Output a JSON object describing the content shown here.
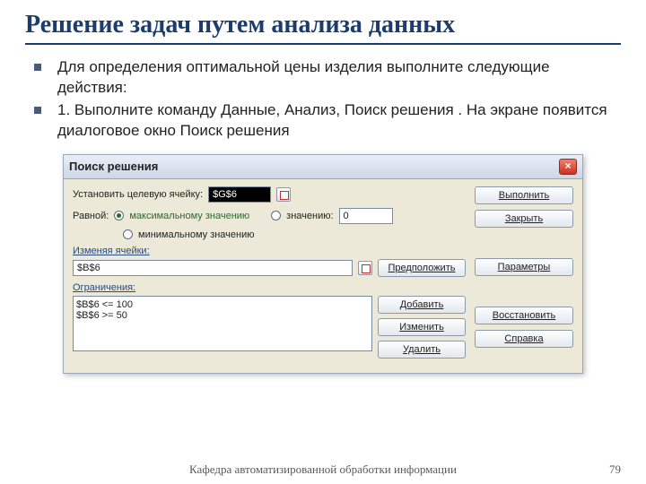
{
  "slide": {
    "title": "Решение задач путем анализа данных",
    "bullets": [
      "Для определения оптимальной цены изделия выполните следующие действия:",
      "1. Выполните команду Данные, Анализ, Поиск решения . На экране появится диалоговое окно Поиск решения"
    ],
    "footer": "Кафедра автоматизированной обработки информации",
    "page": "79"
  },
  "dialog": {
    "title": "Поиск решения",
    "close": "×",
    "labels": {
      "target": "Установить целевую ячейку:",
      "equal": "Равной:",
      "max": "максимальному значению",
      "value": "значению:",
      "min": "минимальному значению",
      "changing": "Изменяя ячейки:",
      "constraints": "Ограничения:"
    },
    "target_cell": "$G$6",
    "value_num": "0",
    "changing_cell": "$B$6",
    "constraints_list": [
      "$B$6 <= 100",
      "$B$6 >= 50"
    ],
    "buttons": {
      "run": "Выполнить",
      "close": "Закрыть",
      "guess": "Предположить",
      "options": "Параметры",
      "add": "Добавить",
      "change": "Изменить",
      "delete": "Удалить",
      "reset": "Восстановить",
      "help": "Справка"
    }
  }
}
